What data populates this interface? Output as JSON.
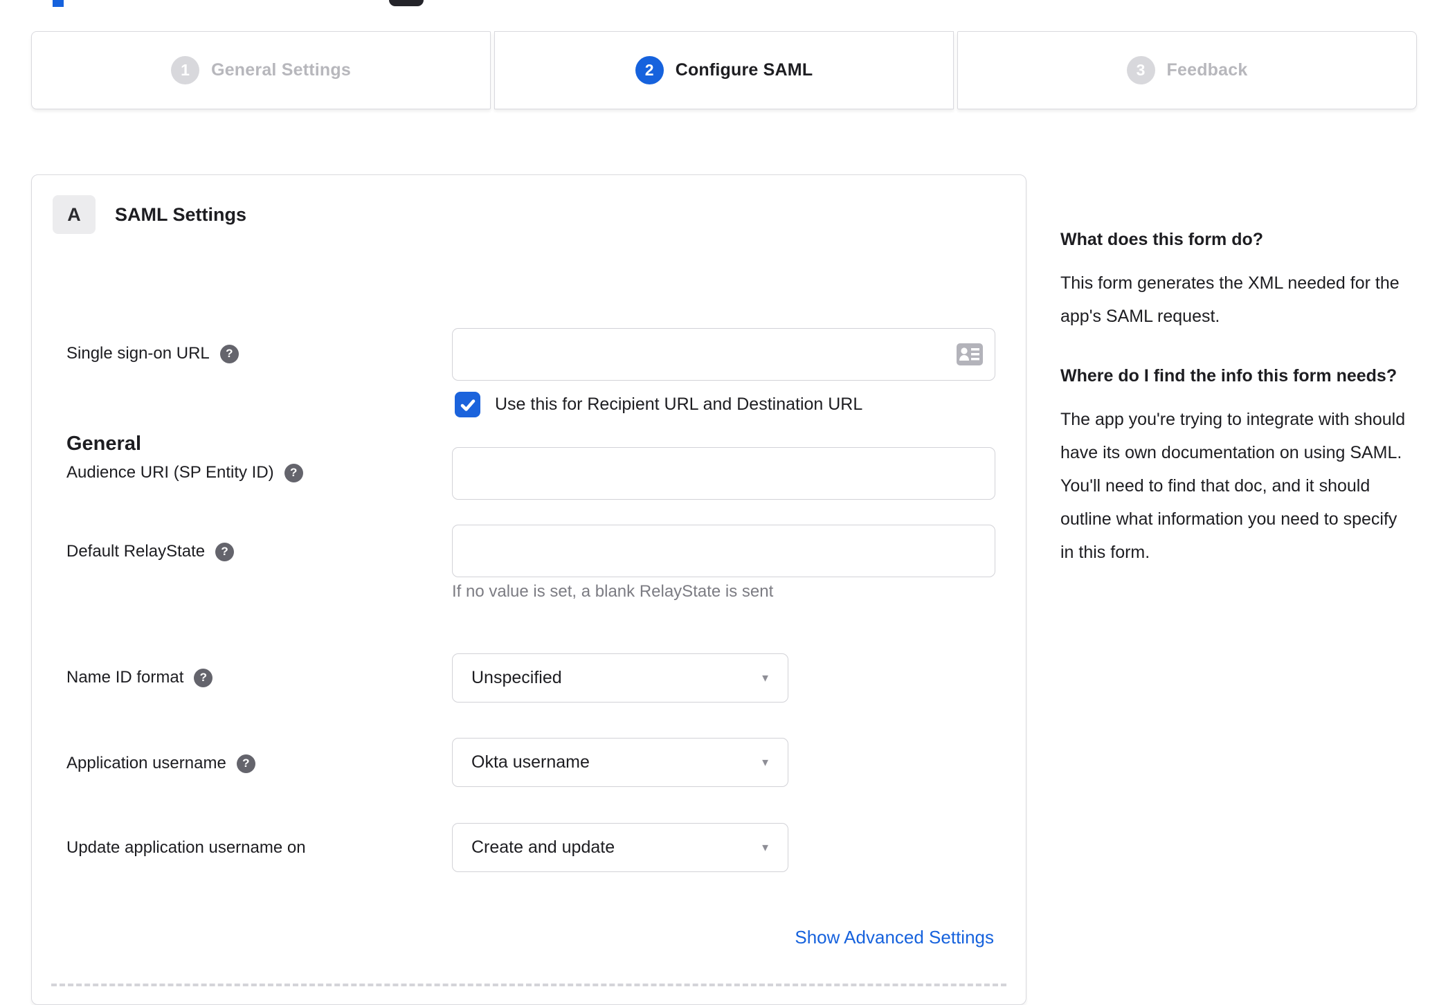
{
  "stepper": {
    "steps": [
      {
        "number": "1",
        "label": "General Settings",
        "state": "inactive"
      },
      {
        "number": "2",
        "label": "Configure SAML",
        "state": "active"
      },
      {
        "number": "3",
        "label": "Feedback",
        "state": "inactive"
      }
    ]
  },
  "form": {
    "section_badge": "A",
    "section_title": "SAML Settings",
    "group_heading": "General",
    "sso": {
      "label": "Single sign-on URL",
      "value": "",
      "checkbox_label": "Use this for Recipient URL and Destination URL",
      "checked": true
    },
    "audience": {
      "label": "Audience URI (SP Entity ID)",
      "value": ""
    },
    "relay_state": {
      "label": "Default RelayState",
      "value": "",
      "hint": "If no value is set, a blank RelayState is sent"
    },
    "name_id_format": {
      "label": "Name ID format",
      "value": "Unspecified"
    },
    "application_username": {
      "label": "Application username",
      "value": "Okta username"
    },
    "update_application_username": {
      "label": "Update application username on",
      "value": "Create and update"
    },
    "advanced_link": "Show Advanced Settings"
  },
  "help_sidebar": {
    "heading_1": "What does this form do?",
    "paragraph_1": "This form generates the XML needed for the app's SAML request.",
    "heading_2": "Where do I find the info this form needs?",
    "paragraph_2": "The app you're trying to integrate with should have its own documentation on using SAML. You'll need to find that doc, and it should outline what information you need to specify in this form."
  },
  "icons": {
    "help_glyph": "?",
    "caret_glyph": "▼",
    "sso_field_icon": "contact-card"
  },
  "colors": {
    "accent_blue": "#1662dd",
    "inactive_gray": "#b7b7bc",
    "badge_gray": "#d8d8dc",
    "border_gray": "#d9d9de",
    "text_dark": "#1d1d21",
    "hint_gray": "#7c7c83"
  }
}
